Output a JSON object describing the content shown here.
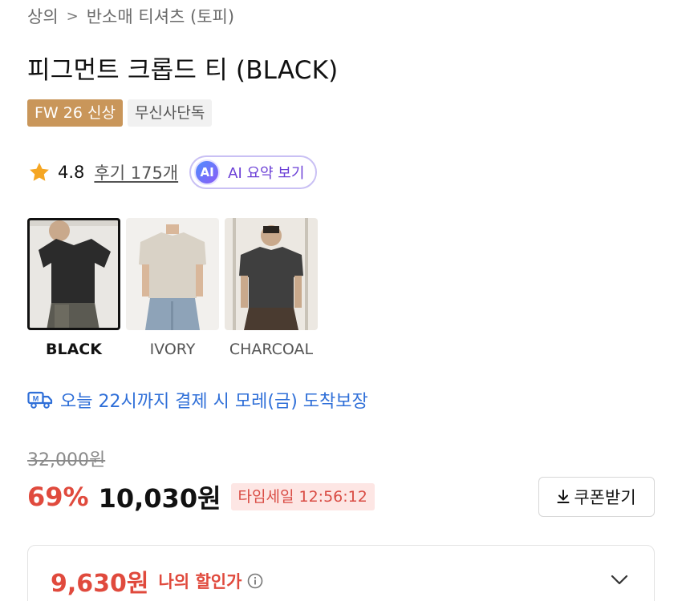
{
  "breadcrumb": {
    "category": "상의",
    "separator": ">",
    "subcategory": "반소매 티셔츠 (토피)"
  },
  "product": {
    "title": "피그먼트 크롭드 티 (BLACK)",
    "badges": [
      "FW 26 신상",
      "무신사단독"
    ]
  },
  "rating": {
    "score": "4.8",
    "reviews_label": "후기 175개",
    "ai_badge": "AI",
    "ai_button_label": "AI 요약 보기"
  },
  "swatches": [
    {
      "label": "BLACK",
      "selected": true,
      "shirt_color": "#2b2b2b"
    },
    {
      "label": "IVORY",
      "selected": false,
      "shirt_color": "#d9d2c6"
    },
    {
      "label": "CHARCOAL",
      "selected": false,
      "shirt_color": "#3f3f3f"
    }
  ],
  "delivery": {
    "icon": "delivery-truck-icon",
    "text": "오늘 22시까지 결제 시 모레(금) 도착보장"
  },
  "price": {
    "original": "32,000원",
    "discount": "69%",
    "current": "10,030원",
    "time_sale": "타임세일 12:56:12",
    "coupon_button": "쿠폰받기"
  },
  "my_price": {
    "value": "9,630원",
    "label": "나의 할인가"
  },
  "colors": {
    "accent_red": "#e04a3d",
    "delivery_blue": "#2f6fd8",
    "badge_gold": "#c9965a",
    "ai_purple": "#6b3fd6"
  }
}
